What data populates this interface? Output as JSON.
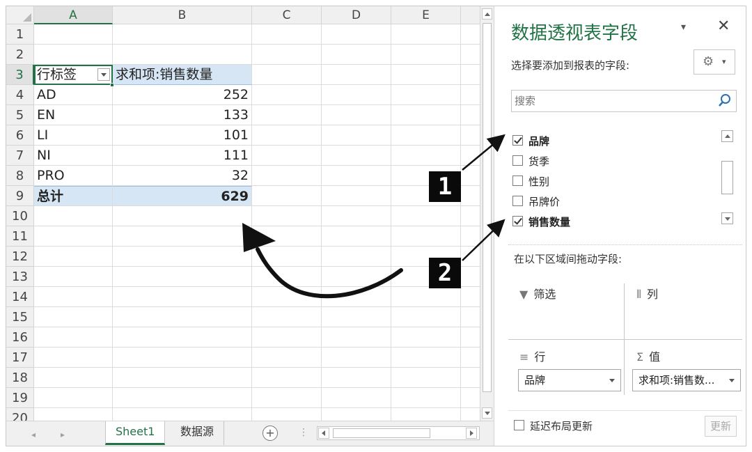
{
  "sheet": {
    "columns": [
      "A",
      "B",
      "C",
      "D",
      "E"
    ],
    "rows": [
      "1",
      "2",
      "3",
      "4",
      "5",
      "6",
      "7",
      "8",
      "9",
      "10",
      "11",
      "12",
      "13",
      "14",
      "15",
      "16",
      "17",
      "18",
      "19",
      "20"
    ],
    "pivot": {
      "row_label_header": "行标签",
      "value_header": "求和项:销售数量",
      "items": [
        {
          "label": "AD",
          "value": "252"
        },
        {
          "label": "EN",
          "value": "133"
        },
        {
          "label": "LI",
          "value": "101"
        },
        {
          "label": "NI",
          "value": "111"
        },
        {
          "label": "PRO",
          "value": "32"
        }
      ],
      "total_label": "总计",
      "total_value": "629"
    },
    "tabs": [
      {
        "label": "Sheet1",
        "active": true
      },
      {
        "label": "数据源",
        "active": false
      }
    ],
    "add_sheet_glyph": "+",
    "tab_nav_prev": "◂",
    "tab_nav_next": "▸",
    "more_glyph": "⋮"
  },
  "pane": {
    "title": "数据透视表字段",
    "dropdown_glyph": "▾",
    "close_glyph": "✕",
    "subtitle": "选择要添加到报表的字段:",
    "gear_glyph": "⚙",
    "gear_caret": "▾",
    "search_placeholder": "搜索",
    "fields": [
      {
        "label": "品牌",
        "checked": true
      },
      {
        "label": "货季",
        "checked": false
      },
      {
        "label": "性别",
        "checked": false
      },
      {
        "label": "吊牌价",
        "checked": false
      },
      {
        "label": "销售数量",
        "checked": true
      }
    ],
    "drag_label": "在以下区域间拖动字段:",
    "areas": {
      "filter": {
        "icon": "▼",
        "label": "筛选"
      },
      "columns": {
        "icon": "⦀",
        "label": "列"
      },
      "rows": {
        "icon": "≡",
        "label": "行",
        "value": "品牌"
      },
      "values": {
        "icon": "Σ",
        "label": "值",
        "value": "求和项:销售数..."
      }
    },
    "defer_label": "延迟布局更新",
    "update_label": "更新"
  },
  "annotations": {
    "badge1": "1",
    "badge2": "2"
  }
}
